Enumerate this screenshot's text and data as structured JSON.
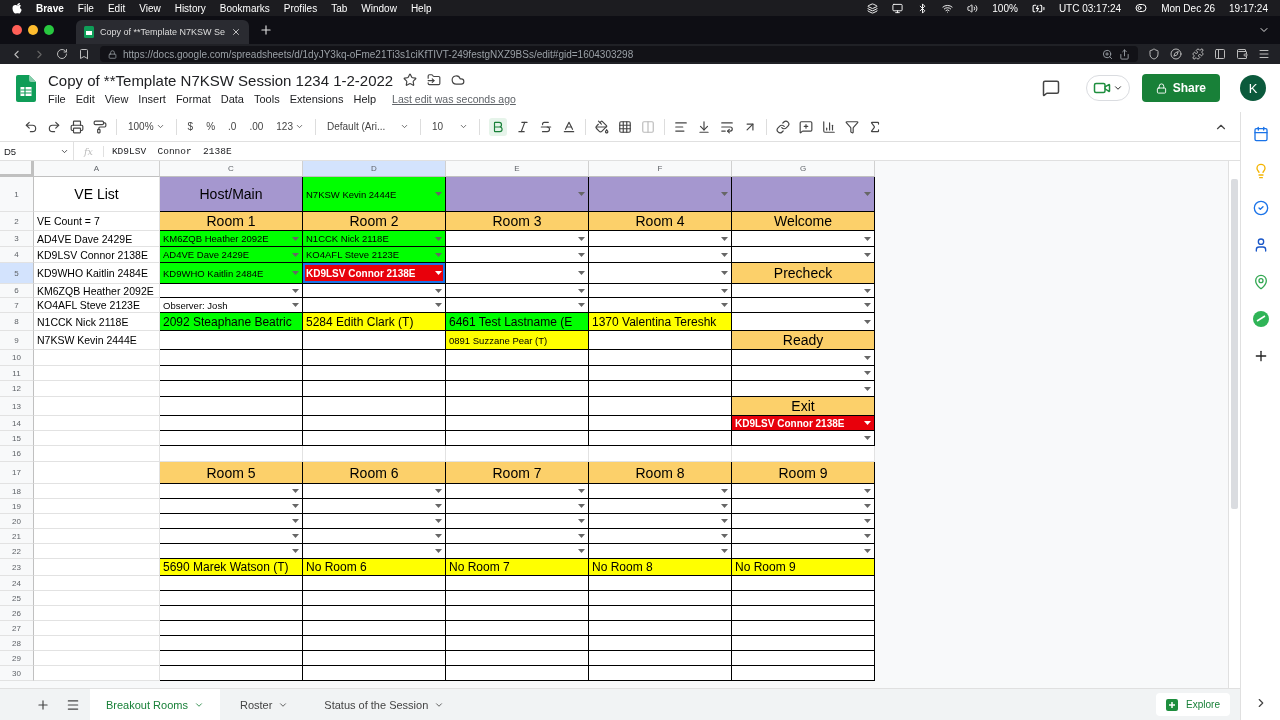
{
  "macos_menu": {
    "app": "Brave",
    "items": [
      "File",
      "Edit",
      "View",
      "History",
      "Bookmarks",
      "Profiles",
      "Tab",
      "Window",
      "Help"
    ],
    "battery": "100%",
    "utc_clock": "UTC 03:17:24",
    "date": "Mon Dec 26",
    "time": "19:17:24"
  },
  "browser": {
    "tab_title": "Copy of **Template N7KSW Se",
    "url": "https://docs.google.com/spreadsheets/d/1dyJY3kq-oFme21Ti3s1ciKfTIVT-249festgNXZ9BSs/edit#gid=1604303298"
  },
  "doc": {
    "title": "Copy of **Template N7KSW Session 1234 1-2-2022",
    "menus": [
      "File",
      "Edit",
      "View",
      "Insert",
      "Format",
      "Data",
      "Tools",
      "Extensions",
      "Help"
    ],
    "last_edit": "Last edit was seconds ago",
    "share": "Share",
    "avatar": "K"
  },
  "toolbar": {
    "zoom": "100%",
    "currency": "$",
    "percent": "%",
    "decrease_decimals": ".0",
    "increase_decimals": ".00",
    "number_format": "123",
    "font": "Default (Ari...",
    "font_size": "10",
    "bold_active": true
  },
  "formula_bar": {
    "cell_ref": "D5",
    "fx": "fx",
    "value": "KD9LSV  Connor  2138E"
  },
  "grid": {
    "columns": [
      {
        "label": "A",
        "selected": false
      },
      {
        "label": "C",
        "selected": false
      },
      {
        "label": "D",
        "selected": true
      },
      {
        "label": "E",
        "selected": false
      },
      {
        "label": "F",
        "selected": false
      },
      {
        "label": "G",
        "selected": false
      }
    ],
    "rows": [
      {
        "number": "1",
        "selected": false,
        "cells": [
          {
            "kind": "header",
            "text": "VE List",
            "dropdown": false,
            "selected": false
          },
          {
            "kind": "header",
            "text": "Host/Main",
            "color": "#a597cf",
            "dropdown": false,
            "selected": false
          },
          {
            "kind": "choice",
            "text": "N7KSW Kevin 2444E",
            "color": "#00ff00",
            "dropdown": true,
            "selected": false
          },
          {
            "kind": "empty",
            "color": "#a597cf",
            "dropdown": true,
            "selected": false
          },
          {
            "kind": "empty",
            "color": "#a597cf",
            "dropdown": true,
            "selected": false
          },
          {
            "kind": "empty",
            "color": "#a597cf",
            "dropdown": true,
            "selected": false
          }
        ]
      },
      {
        "number": "2",
        "selected": false,
        "cells": [
          {
            "kind": "plain",
            "text": "VE Count = 7",
            "dropdown": false,
            "selected": false
          },
          {
            "kind": "header",
            "text": "Room 1",
            "color": "#fcd06a",
            "dropdown": false,
            "selected": false
          },
          {
            "kind": "header",
            "text": "Room 2",
            "color": "#fcd06a",
            "dropdown": false,
            "selected": false
          },
          {
            "kind": "header",
            "text": "Room 3",
            "color": "#fcd06a",
            "dropdown": false,
            "selected": false
          },
          {
            "kind": "header",
            "text": "Room 4",
            "color": "#fcd06a",
            "dropdown": false,
            "selected": false
          },
          {
            "kind": "header",
            "text": "Welcome",
            "color": "#fcd06a",
            "dropdown": false,
            "selected": false
          }
        ]
      },
      {
        "number": "3",
        "selected": false,
        "cells": [
          {
            "kind": "plain",
            "text": "AD4VE Dave 2429E",
            "dropdown": false,
            "selected": false
          },
          {
            "kind": "choice",
            "text": "KM6ZQB Heather 2092E",
            "color": "#00ff00",
            "dropdown": true,
            "selected": false
          },
          {
            "kind": "choice",
            "text": "N1CCK Nick 2118E",
            "color": "#00ff00",
            "dropdown": true,
            "selected": false
          },
          {
            "kind": "empty",
            "dropdown": true,
            "selected": false
          },
          {
            "kind": "empty",
            "dropdown": true,
            "selected": false
          },
          {
            "kind": "empty",
            "dropdown": true,
            "selected": false
          }
        ]
      },
      {
        "number": "4",
        "selected": false,
        "cells": [
          {
            "kind": "plain",
            "text": "KD9LSV Connor 2138E",
            "dropdown": false,
            "selected": false
          },
          {
            "kind": "choice",
            "text": "AD4VE Dave 2429E",
            "color": "#00ff00",
            "dropdown": true,
            "selected": false
          },
          {
            "kind": "choice",
            "text": "KO4AFL Steve 2123E",
            "color": "#00ff00",
            "dropdown": true,
            "selected": false
          },
          {
            "kind": "empty",
            "dropdown": true,
            "selected": false
          },
          {
            "kind": "empty",
            "dropdown": true,
            "selected": false
          },
          {
            "kind": "empty",
            "dropdown": true,
            "selected": false
          }
        ]
      },
      {
        "number": "5",
        "selected": true,
        "cells": [
          {
            "kind": "plain",
            "text": "KD9WHO Kaitlin 2484E",
            "dropdown": false,
            "selected": false
          },
          {
            "kind": "choice",
            "text": "KD9WHO Kaitlin 2484E",
            "color": "#00ff00",
            "dropdown": true,
            "selected": false
          },
          {
            "kind": "alert",
            "text": "KD9LSV Connor 2138E",
            "color": "#e8000b",
            "dropdown": true,
            "selected": true
          },
          {
            "kind": "empty",
            "dropdown": true,
            "selected": false
          },
          {
            "kind": "empty",
            "dropdown": true,
            "selected": false
          },
          {
            "kind": "header",
            "text": "Precheck",
            "color": "#fcd06a",
            "dropdown": false,
            "selected": false
          }
        ]
      },
      {
        "number": "6",
        "selected": false,
        "cells": [
          {
            "kind": "plain",
            "text": "KM6ZQB Heather 2092E",
            "dropdown": false,
            "selected": false
          },
          {
            "kind": "empty",
            "dropdown": true,
            "selected": false
          },
          {
            "kind": "empty",
            "dropdown": true,
            "selected": false
          },
          {
            "kind": "empty",
            "dropdown": true,
            "selected": false
          },
          {
            "kind": "empty",
            "dropdown": true,
            "selected": false
          },
          {
            "kind": "empty",
            "dropdown": true,
            "selected": false
          }
        ]
      },
      {
        "number": "7",
        "selected": false,
        "cells": [
          {
            "kind": "plain",
            "text": "KO4AFL Steve 2123E",
            "dropdown": false,
            "selected": false
          },
          {
            "kind": "choice",
            "text": "Observer: Josh",
            "dropdown": true,
            "selected": false
          },
          {
            "kind": "empty",
            "dropdown": true,
            "selected": false
          },
          {
            "kind": "empty",
            "dropdown": true,
            "selected": false
          },
          {
            "kind": "empty",
            "dropdown": true,
            "selected": false
          },
          {
            "kind": "empty",
            "dropdown": true,
            "selected": false
          }
        ]
      },
      {
        "number": "8",
        "selected": false,
        "cells": [
          {
            "kind": "plain",
            "text": "N1CCK Nick 2118E",
            "dropdown": false,
            "selected": false
          },
          {
            "kind": "entry",
            "text": "2092 Steaphane Beatric",
            "color": "#00ff00",
            "dropdown": false,
            "selected": false
          },
          {
            "kind": "entry",
            "text": "5284 Edith Clark (T)",
            "color": "#ffff00",
            "dropdown": false,
            "selected": false
          },
          {
            "kind": "entry",
            "text": "6461 Test Lastname (E",
            "color": "#00ff00",
            "dropdown": false,
            "selected": false
          },
          {
            "kind": "entry",
            "text": "1370 Valentina Tereshk",
            "color": "#ffff00",
            "dropdown": false,
            "selected": false
          },
          {
            "kind": "empty",
            "dropdown": true,
            "selected": false
          }
        ]
      },
      {
        "number": "9",
        "selected": false,
        "cells": [
          {
            "kind": "plain",
            "text": "N7KSW Kevin 2444E",
            "dropdown": false,
            "selected": false
          },
          {
            "kind": "empty",
            "dropdown": false,
            "selected": false
          },
          {
            "kind": "empty",
            "dropdown": false,
            "selected": false
          },
          {
            "kind": "choice",
            "text": "0891 Suzzane Pear (T)",
            "color": "#ffff00",
            "dropdown": false,
            "selected": false
          },
          {
            "kind": "empty",
            "dropdown": false,
            "selected": false
          },
          {
            "kind": "header",
            "text": "Ready",
            "color": "#fcd06a",
            "dropdown": false,
            "selected": false
          }
        ]
      },
      {
        "number": "10",
        "selected": false,
        "cells": [
          {
            "kind": "empty",
            "dropdown": false,
            "selected": false
          },
          {
            "kind": "empty",
            "dropdown": false,
            "selected": false
          },
          {
            "kind": "empty",
            "dropdown": false,
            "selected": false
          },
          {
            "kind": "empty",
            "dropdown": false,
            "selected": false
          },
          {
            "kind": "empty",
            "dropdown": false,
            "selected": false
          },
          {
            "kind": "empty",
            "dropdown": true,
            "selected": false
          }
        ]
      },
      {
        "number": "11",
        "selected": false,
        "cells": [
          {
            "kind": "empty",
            "dropdown": false,
            "selected": false
          },
          {
            "kind": "empty",
            "dropdown": false,
            "selected": false
          },
          {
            "kind": "empty",
            "dropdown": false,
            "selected": false
          },
          {
            "kind": "empty",
            "dropdown": false,
            "selected": false
          },
          {
            "kind": "empty",
            "dropdown": false,
            "selected": false
          },
          {
            "kind": "empty",
            "dropdown": true,
            "selected": false
          }
        ]
      },
      {
        "number": "12",
        "selected": false,
        "cells": [
          {
            "kind": "empty",
            "dropdown": false,
            "selected": false
          },
          {
            "kind": "empty",
            "dropdown": false,
            "selected": false
          },
          {
            "kind": "empty",
            "dropdown": false,
            "selected": false
          },
          {
            "kind": "empty",
            "dropdown": false,
            "selected": false
          },
          {
            "kind": "empty",
            "dropdown": false,
            "selected": false
          },
          {
            "kind": "empty",
            "dropdown": true,
            "selected": false
          }
        ]
      },
      {
        "number": "13",
        "selected": false,
        "cells": [
          {
            "kind": "empty",
            "dropdown": false,
            "selected": false
          },
          {
            "kind": "empty",
            "dropdown": false,
            "selected": false
          },
          {
            "kind": "empty",
            "dropdown": false,
            "selected": false
          },
          {
            "kind": "empty",
            "dropdown": false,
            "selected": false
          },
          {
            "kind": "empty",
            "dropdown": false,
            "selected": false
          },
          {
            "kind": "header",
            "text": "Exit",
            "color": "#fcd06a",
            "dropdown": false,
            "selected": false
          }
        ]
      },
      {
        "number": "14",
        "selected": false,
        "cells": [
          {
            "kind": "empty",
            "dropdown": false,
            "selected": false
          },
          {
            "kind": "empty",
            "dropdown": false,
            "selected": false
          },
          {
            "kind": "empty",
            "dropdown": false,
            "selected": false
          },
          {
            "kind": "empty",
            "dropdown": false,
            "selected": false
          },
          {
            "kind": "empty",
            "dropdown": false,
            "selected": false
          },
          {
            "kind": "alert",
            "text": "KD9LSV Connor 2138E",
            "color": "#e8000b",
            "dropdown": true,
            "selected": false
          }
        ]
      },
      {
        "number": "15",
        "selected": false,
        "cells": [
          {
            "kind": "empty",
            "dropdown": false,
            "selected": false
          },
          {
            "kind": "empty",
            "dropdown": false,
            "selected": false
          },
          {
            "kind": "empty",
            "dropdown": false,
            "selected": false
          },
          {
            "kind": "empty",
            "dropdown": false,
            "selected": false
          },
          {
            "kind": "empty",
            "dropdown": false,
            "selected": false
          },
          {
            "kind": "empty",
            "dropdown": true,
            "selected": false
          }
        ]
      },
      {
        "number": "16",
        "selected": false,
        "cells": [
          {
            "kind": "empty",
            "dropdown": false,
            "selected": false
          },
          {
            "kind": "empty",
            "dropdown": false,
            "selected": false
          },
          {
            "kind": "empty",
            "dropdown": false,
            "selected": false
          },
          {
            "kind": "empty",
            "dropdown": false,
            "selected": false
          },
          {
            "kind": "empty",
            "dropdown": false,
            "selected": false
          },
          {
            "kind": "empty",
            "dropdown": false,
            "selected": false
          }
        ]
      },
      {
        "number": "17",
        "selected": false,
        "cells": [
          {
            "kind": "empty",
            "dropdown": false,
            "selected": false
          },
          {
            "kind": "header",
            "text": "Room 5",
            "color": "#fcd06a",
            "dropdown": false,
            "selected": false
          },
          {
            "kind": "header",
            "text": "Room 6",
            "color": "#fcd06a",
            "dropdown": false,
            "selected": false
          },
          {
            "kind": "header",
            "text": "Room 7",
            "color": "#fcd06a",
            "dropdown": false,
            "selected": false
          },
          {
            "kind": "header",
            "text": "Room 8",
            "color": "#fcd06a",
            "dropdown": false,
            "selected": false
          },
          {
            "kind": "header",
            "text": "Room 9",
            "color": "#fcd06a",
            "dropdown": false,
            "selected": false
          }
        ]
      },
      {
        "number": "18",
        "selected": false,
        "cells": [
          {
            "kind": "empty",
            "dropdown": false,
            "selected": false
          },
          {
            "kind": "empty",
            "dropdown": true,
            "selected": false
          },
          {
            "kind": "empty",
            "dropdown": true,
            "selected": false
          },
          {
            "kind": "empty",
            "dropdown": true,
            "selected": false
          },
          {
            "kind": "empty",
            "dropdown": true,
            "selected": false
          },
          {
            "kind": "empty",
            "dropdown": true,
            "selected": false
          }
        ]
      },
      {
        "number": "19",
        "selected": false,
        "cells": [
          {
            "kind": "empty",
            "dropdown": false,
            "selected": false
          },
          {
            "kind": "empty",
            "dropdown": true,
            "selected": false
          },
          {
            "kind": "empty",
            "dropdown": true,
            "selected": false
          },
          {
            "kind": "empty",
            "dropdown": true,
            "selected": false
          },
          {
            "kind": "empty",
            "dropdown": true,
            "selected": false
          },
          {
            "kind": "empty",
            "dropdown": true,
            "selected": false
          }
        ]
      },
      {
        "number": "20",
        "selected": false,
        "cells": [
          {
            "kind": "empty",
            "dropdown": false,
            "selected": false
          },
          {
            "kind": "empty",
            "dropdown": true,
            "selected": false
          },
          {
            "kind": "empty",
            "dropdown": true,
            "selected": false
          },
          {
            "kind": "empty",
            "dropdown": true,
            "selected": false
          },
          {
            "kind": "empty",
            "dropdown": true,
            "selected": false
          },
          {
            "kind": "empty",
            "dropdown": true,
            "selected": false
          }
        ]
      },
      {
        "number": "21",
        "selected": false,
        "cells": [
          {
            "kind": "empty",
            "dropdown": false,
            "selected": false
          },
          {
            "kind": "empty",
            "dropdown": true,
            "selected": false
          },
          {
            "kind": "empty",
            "dropdown": true,
            "selected": false
          },
          {
            "kind": "empty",
            "dropdown": true,
            "selected": false
          },
          {
            "kind": "empty",
            "dropdown": true,
            "selected": false
          },
          {
            "kind": "empty",
            "dropdown": true,
            "selected": false
          }
        ]
      },
      {
        "number": "22",
        "selected": false,
        "cells": [
          {
            "kind": "empty",
            "dropdown": false,
            "selected": false
          },
          {
            "kind": "empty",
            "dropdown": true,
            "selected": false
          },
          {
            "kind": "empty",
            "dropdown": true,
            "selected": false
          },
          {
            "kind": "empty",
            "dropdown": true,
            "selected": false
          },
          {
            "kind": "empty",
            "dropdown": true,
            "selected": false
          },
          {
            "kind": "empty",
            "dropdown": true,
            "selected": false
          }
        ]
      },
      {
        "number": "23",
        "selected": false,
        "cells": [
          {
            "kind": "empty",
            "dropdown": false,
            "selected": false
          },
          {
            "kind": "entry",
            "text": "5690 Marek Watson (T)",
            "color": "#ffff00",
            "dropdown": false,
            "selected": false
          },
          {
            "kind": "entry",
            "text": "No Room 6",
            "color": "#ffff00",
            "dropdown": false,
            "selected": false
          },
          {
            "kind": "entry",
            "text": "No Room 7",
            "color": "#ffff00",
            "dropdown": false,
            "selected": false
          },
          {
            "kind": "entry",
            "text": "No Room 8",
            "color": "#ffff00",
            "dropdown": false,
            "selected": false
          },
          {
            "kind": "entry",
            "text": "No Room 9",
            "color": "#ffff00",
            "dropdown": false,
            "selected": false
          }
        ]
      },
      {
        "number": "24",
        "selected": false,
        "cells": [
          {
            "kind": "empty",
            "dropdown": false,
            "selected": false
          },
          {
            "kind": "empty",
            "dropdown": false,
            "selected": false
          },
          {
            "kind": "empty",
            "dropdown": false,
            "selected": false
          },
          {
            "kind": "empty",
            "dropdown": false,
            "selected": false
          },
          {
            "kind": "empty",
            "dropdown": false,
            "selected": false
          },
          {
            "kind": "empty",
            "dropdown": false,
            "selected": false
          }
        ]
      },
      {
        "number": "25",
        "selected": false,
        "cells": [
          {
            "kind": "empty",
            "dropdown": false,
            "selected": false
          },
          {
            "kind": "empty",
            "dropdown": false,
            "selected": false
          },
          {
            "kind": "empty",
            "dropdown": false,
            "selected": false
          },
          {
            "kind": "empty",
            "dropdown": false,
            "selected": false
          },
          {
            "kind": "empty",
            "dropdown": false,
            "selected": false
          },
          {
            "kind": "empty",
            "dropdown": false,
            "selected": false
          }
        ]
      },
      {
        "number": "26",
        "selected": false,
        "cells": [
          {
            "kind": "empty",
            "dropdown": false,
            "selected": false
          },
          {
            "kind": "empty",
            "dropdown": false,
            "selected": false
          },
          {
            "kind": "empty",
            "dropdown": false,
            "selected": false
          },
          {
            "kind": "empty",
            "dropdown": false,
            "selected": false
          },
          {
            "kind": "empty",
            "dropdown": false,
            "selected": false
          },
          {
            "kind": "empty",
            "dropdown": false,
            "selected": false
          }
        ]
      },
      {
        "number": "27",
        "selected": false,
        "cells": [
          {
            "kind": "empty",
            "dropdown": false,
            "selected": false
          },
          {
            "kind": "empty",
            "dropdown": false,
            "selected": false
          },
          {
            "kind": "empty",
            "dropdown": false,
            "selected": false
          },
          {
            "kind": "empty",
            "dropdown": false,
            "selected": false
          },
          {
            "kind": "empty",
            "dropdown": false,
            "selected": false
          },
          {
            "kind": "empty",
            "dropdown": false,
            "selected": false
          }
        ]
      },
      {
        "number": "28",
        "selected": false,
        "cells": [
          {
            "kind": "empty",
            "dropdown": false,
            "selected": false
          },
          {
            "kind": "empty",
            "dropdown": false,
            "selected": false
          },
          {
            "kind": "empty",
            "dropdown": false,
            "selected": false
          },
          {
            "kind": "empty",
            "dropdown": false,
            "selected": false
          },
          {
            "kind": "empty",
            "dropdown": false,
            "selected": false
          },
          {
            "kind": "empty",
            "dropdown": false,
            "selected": false
          }
        ]
      },
      {
        "number": "29",
        "selected": false,
        "cells": [
          {
            "kind": "empty",
            "dropdown": false,
            "selected": false
          },
          {
            "kind": "empty",
            "dropdown": false,
            "selected": false
          },
          {
            "kind": "empty",
            "dropdown": false,
            "selected": false
          },
          {
            "kind": "empty",
            "dropdown": false,
            "selected": false
          },
          {
            "kind": "empty",
            "dropdown": false,
            "selected": false
          },
          {
            "kind": "empty",
            "dropdown": false,
            "selected": false
          }
        ]
      },
      {
        "number": "30",
        "selected": false,
        "cells": [
          {
            "kind": "empty",
            "dropdown": false,
            "selected": false
          },
          {
            "kind": "empty",
            "dropdown": false,
            "selected": false
          },
          {
            "kind": "empty",
            "dropdown": false,
            "selected": false
          },
          {
            "kind": "empty",
            "dropdown": false,
            "selected": false
          },
          {
            "kind": "empty",
            "dropdown": false,
            "selected": false
          },
          {
            "kind": "empty",
            "dropdown": false,
            "selected": false
          }
        ]
      }
    ]
  },
  "sheets": {
    "tabs": [
      {
        "label": "Breakout Rooms",
        "selected": true
      },
      {
        "label": "Roster",
        "selected": false
      },
      {
        "label": "Status of the Session",
        "selected": false
      }
    ],
    "explore": "Explore"
  }
}
